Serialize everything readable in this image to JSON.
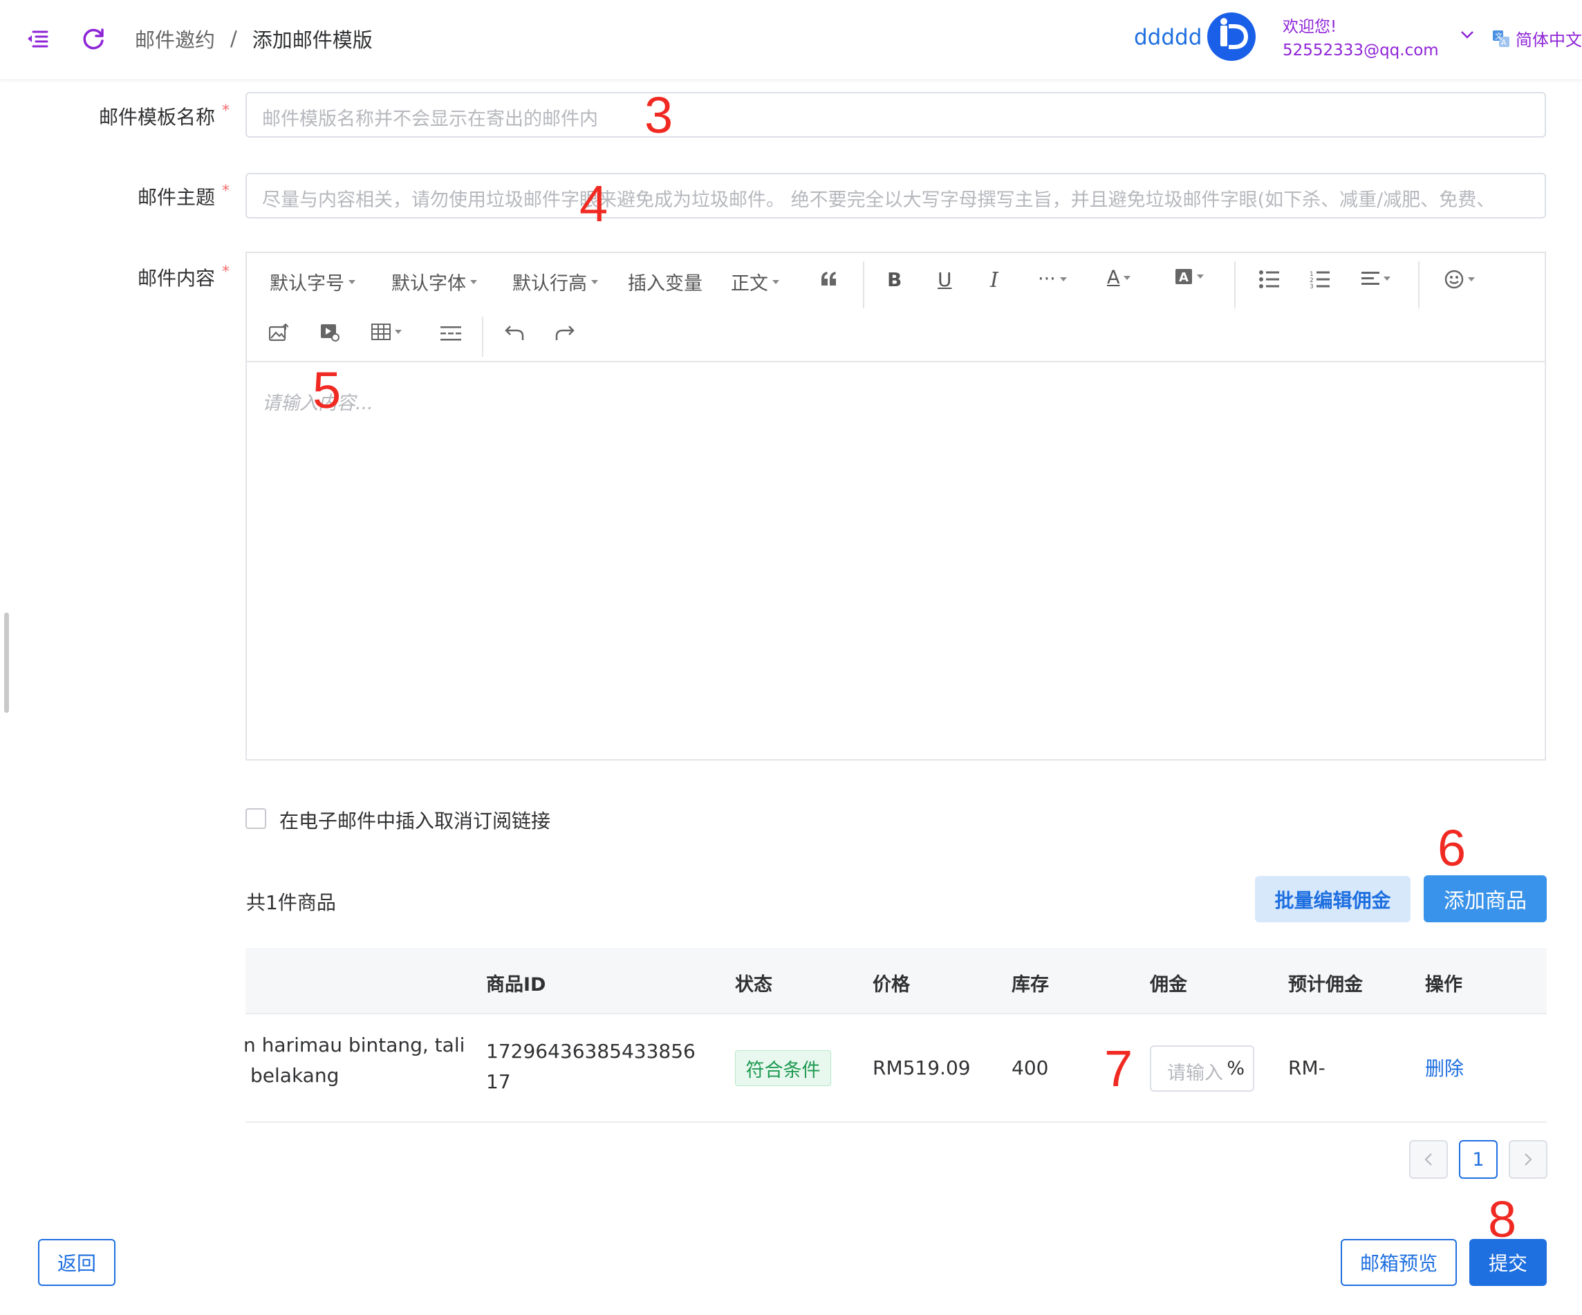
{
  "header": {
    "breadcrumb": [
      "邮件邀约",
      "/",
      "添加邮件模版"
    ],
    "username": "ddddd",
    "welcome": "欢迎您!",
    "email": "52552333@qq.com",
    "language": "简体中文",
    "accent_color": "#8e24d6",
    "link_color": "#1e6fe0"
  },
  "form": {
    "template_name": {
      "label": "邮件模板名称",
      "placeholder": "邮件模版名称并不会显示在寄出的邮件内"
    },
    "subject": {
      "label": "邮件主题",
      "placeholder": "尽量与内容相关，请勿使用垃圾邮件字眼来避免成为垃圾邮件。 绝不要完全以大写字母撰写主旨，并且避免垃圾邮件字眼(如下杀、减重/减肥、免费、"
    },
    "content": {
      "label": "邮件内容",
      "placeholder": "请输入内容..."
    },
    "required_mark": "*"
  },
  "toolbar": {
    "font_size": "默认字号",
    "font_family": "默认字体",
    "line_height": "默认行高",
    "insert_variable": "插入变量",
    "paragraph": "正文",
    "icons": [
      "quote-icon",
      "bold-icon",
      "underline-icon",
      "italic-icon",
      "more-icon",
      "font-color-icon",
      "bg-color-icon",
      "bullet-list-icon",
      "numbered-list-icon",
      "align-icon",
      "emoji-icon",
      "image-icon",
      "video-icon",
      "table-icon",
      "divider-icon",
      "undo-icon",
      "redo-icon"
    ]
  },
  "unsubscribe": {
    "label": "在电子邮件中插入取消订阅链接",
    "checked": false
  },
  "products": {
    "count_text": "共1件商品",
    "batch_edit": "批量编辑佣金",
    "add_product": "添加商品",
    "columns": [
      "商品ID",
      "状态",
      "价格",
      "库存",
      "佣金",
      "预计佣金",
      "操作"
    ],
    "rows": [
      {
        "name_line1": "n harimau bintang, tali",
        "name_line2": "belakang",
        "id_line1": "17296436385433856",
        "id_line2": "17",
        "status": "符合条件",
        "price": "RM519.09",
        "stock": "400",
        "commission_placeholder": "请输入",
        "commission_unit": "%",
        "estimated": "RM-",
        "action": "删除"
      }
    ]
  },
  "pagination": {
    "current": "1"
  },
  "footer": {
    "back": "返回",
    "preview": "邮箱预览",
    "submit": "提交"
  },
  "annotations": [
    "3",
    "4",
    "5",
    "6",
    "7",
    "8"
  ]
}
